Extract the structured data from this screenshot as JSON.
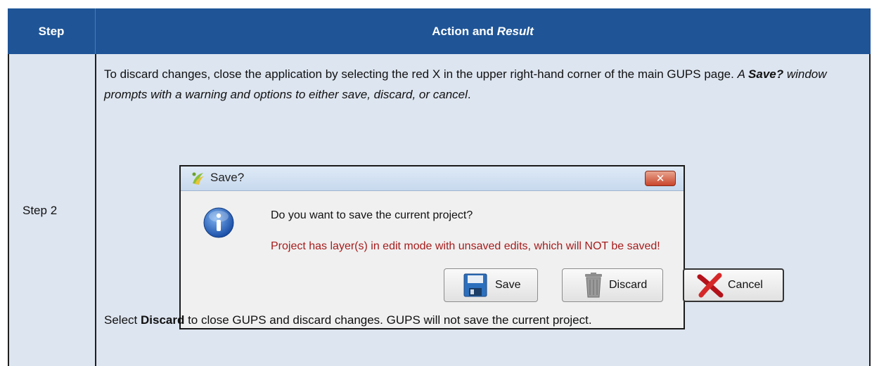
{
  "table": {
    "header": {
      "step": "Step",
      "action_prefix": "Action and ",
      "action_italic": "Result"
    },
    "row": {
      "step": "Step 2",
      "para1": {
        "text": "To discard changes, close the application by selecting the red X in the upper right-hand corner of the main GUPS page. ",
        "italic_a": "A ",
        "bold_italic": "Save?",
        "italic_b": " window prompts with a warning and options to either save, discard, or cancel",
        "end": "."
      },
      "para2": {
        "a": "Select ",
        "bold": "Discard",
        "b": " to close GUPS and discard changes. GUPS will not save the current project."
      }
    }
  },
  "dialog": {
    "title": "Save?",
    "close_glyph": "✕",
    "question": "Do you want to save the current project?",
    "warning": "Project has layer(s) in edit mode with unsaved edits, which will NOT be saved!",
    "buttons": {
      "save": "Save",
      "discard": "Discard",
      "cancel": "Cancel"
    },
    "icons": {
      "title": "qgis-logo-icon",
      "info": "info-icon",
      "save": "floppy-disk-icon",
      "discard": "trash-can-icon",
      "cancel": "red-x-icon"
    },
    "colors": {
      "warning_text": "#a61c1c",
      "close_button": "#c9452c"
    }
  },
  "colors": {
    "header_bg": "#1f5597",
    "row_bg": "#dde5f0"
  }
}
